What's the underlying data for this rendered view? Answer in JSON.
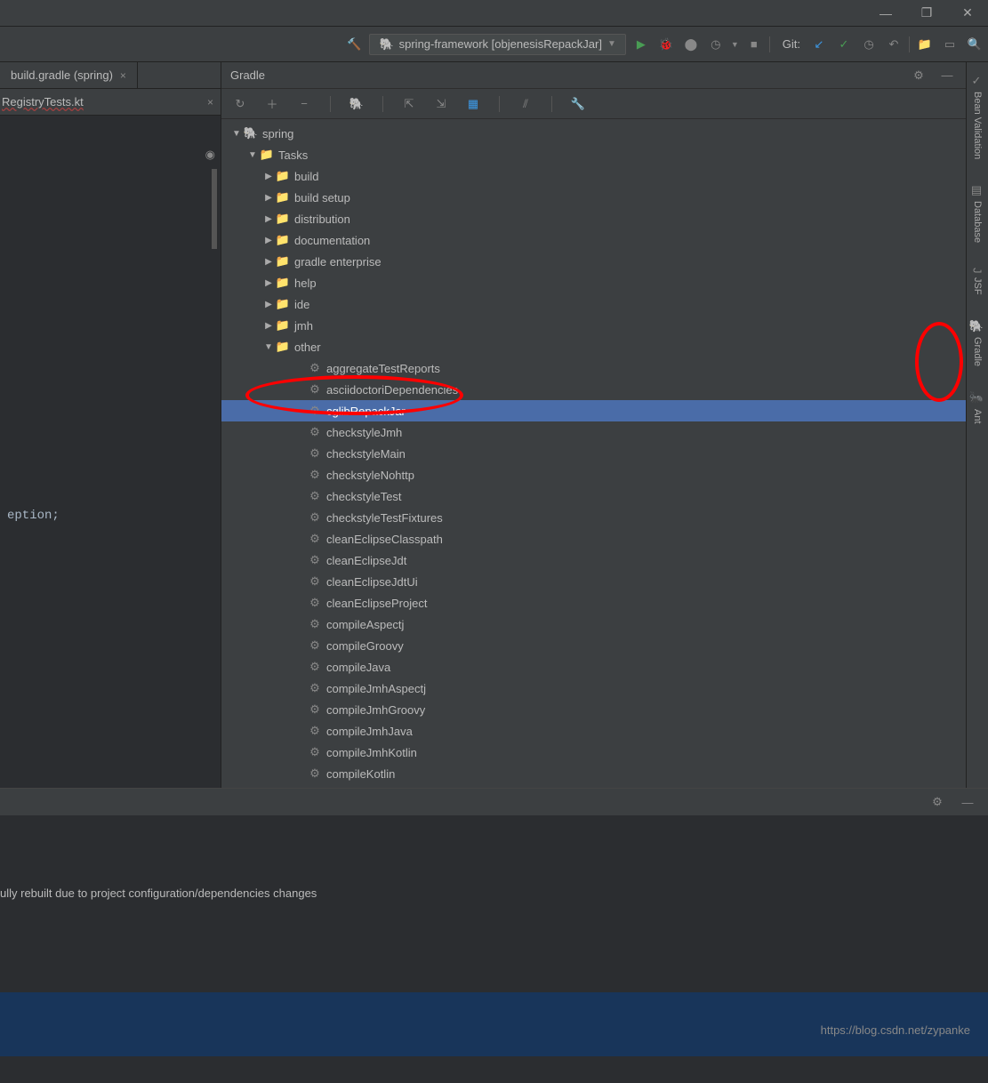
{
  "titlebar": {
    "minimize": "—",
    "maximize": "❐",
    "close": "✕"
  },
  "toolbar": {
    "hammer": "🔨",
    "run_config_label": "spring-framework [objenesisRepackJar]",
    "run": "▶",
    "debug": "🐞",
    "coverage": "⬤",
    "profile": "◷",
    "stop": "■",
    "git_label": "Git:",
    "update": "↙",
    "commit": "✓",
    "history": "◷",
    "undo": "↶",
    "folder": "📁",
    "sidebar": "▭",
    "search": "🔍"
  },
  "editor": {
    "tab1_label": "build.gradle (spring)",
    "tab2_label": "RegistryTests.kt",
    "close": "×",
    "code_line": "eption;"
  },
  "gradle": {
    "header_title": "Gradle",
    "gear": "⚙",
    "minimize": "—",
    "tb_refresh": "↻",
    "tb_add": "＋",
    "tb_remove": "−",
    "tb_elephant": "🐘",
    "tb_expand": "⇱",
    "tb_collapse": "⇲",
    "tb_offline": "▦",
    "tb_build": "⫽",
    "tb_wrench": "🔧",
    "tree": {
      "root": "spring",
      "tasks": "Tasks",
      "folders": [
        "build",
        "build setup",
        "distribution",
        "documentation",
        "gradle enterprise",
        "help",
        "ide",
        "jmh",
        "other"
      ],
      "other_tasks": [
        "aggregateTestReports",
        "asciidoctoriDependencies",
        "cglibRepackJar",
        "checkstyleJmh",
        "checkstyleMain",
        "checkstyleNohttp",
        "checkstyleTest",
        "checkstyleTestFixtures",
        "cleanEclipseClasspath",
        "cleanEclipseJdt",
        "cleanEclipseJdtUi",
        "cleanEclipseProject",
        "compileAspectj",
        "compileGroovy",
        "compileJava",
        "compileJmhAspectj",
        "compileJmhGroovy",
        "compileJmhJava",
        "compileJmhKotlin",
        "compileKotlin"
      ],
      "selected_index": 2
    }
  },
  "right_sidebar": {
    "tabs": [
      {
        "icon": "✓",
        "label": "Bean Validation"
      },
      {
        "icon": "▤",
        "label": "Database"
      },
      {
        "icon": "J",
        "label": "JSF"
      },
      {
        "icon": "🐘",
        "label": "Gradle"
      },
      {
        "icon": "🐜",
        "label": "Ant"
      }
    ]
  },
  "bottom": {
    "gear": "⚙",
    "minimize": "—",
    "msg": "ully rebuilt due to project configuration/dependencies changes"
  },
  "watermark": "https://blog.csdn.net/zypanke"
}
